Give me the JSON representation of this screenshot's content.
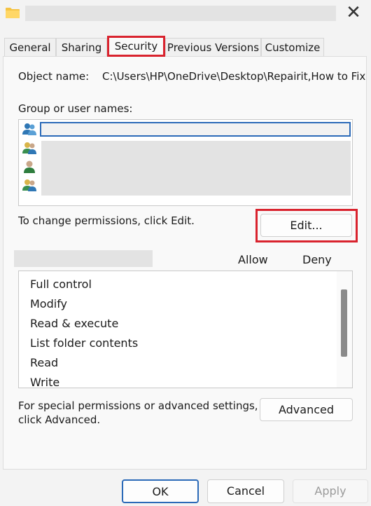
{
  "window": {
    "close_glyph": "✕"
  },
  "tabs": [
    {
      "label": "General"
    },
    {
      "label": "Sharing"
    },
    {
      "label": "Security"
    },
    {
      "label": "Previous Versions"
    },
    {
      "label": "Customize"
    }
  ],
  "object": {
    "label": "Object name:",
    "value": "C:\\Users\\HP\\OneDrive\\Desktop\\Repairit,How to Fix"
  },
  "users": {
    "label": "Group or user names:",
    "icons": [
      "group-users-icon",
      "user-pair-icon",
      "single-user-icon",
      "user-pair-icon"
    ]
  },
  "edit": {
    "hint": "To change permissions, click Edit.",
    "button": "Edit..."
  },
  "permissions": {
    "allow_label": "Allow",
    "deny_label": "Deny",
    "items": [
      "Full control",
      "Modify",
      "Read & execute",
      "List folder contents",
      "Read",
      "Write"
    ]
  },
  "advanced": {
    "hint_line1": "For special permissions or advanced settings,",
    "hint_line2": "click Advanced.",
    "button": "Advanced"
  },
  "footer": {
    "ok": "OK",
    "cancel": "Cancel",
    "apply": "Apply"
  },
  "colors": {
    "highlight": "#d9232e",
    "selection": "#2b6ab8",
    "ok_border": "#2b6ab8"
  }
}
